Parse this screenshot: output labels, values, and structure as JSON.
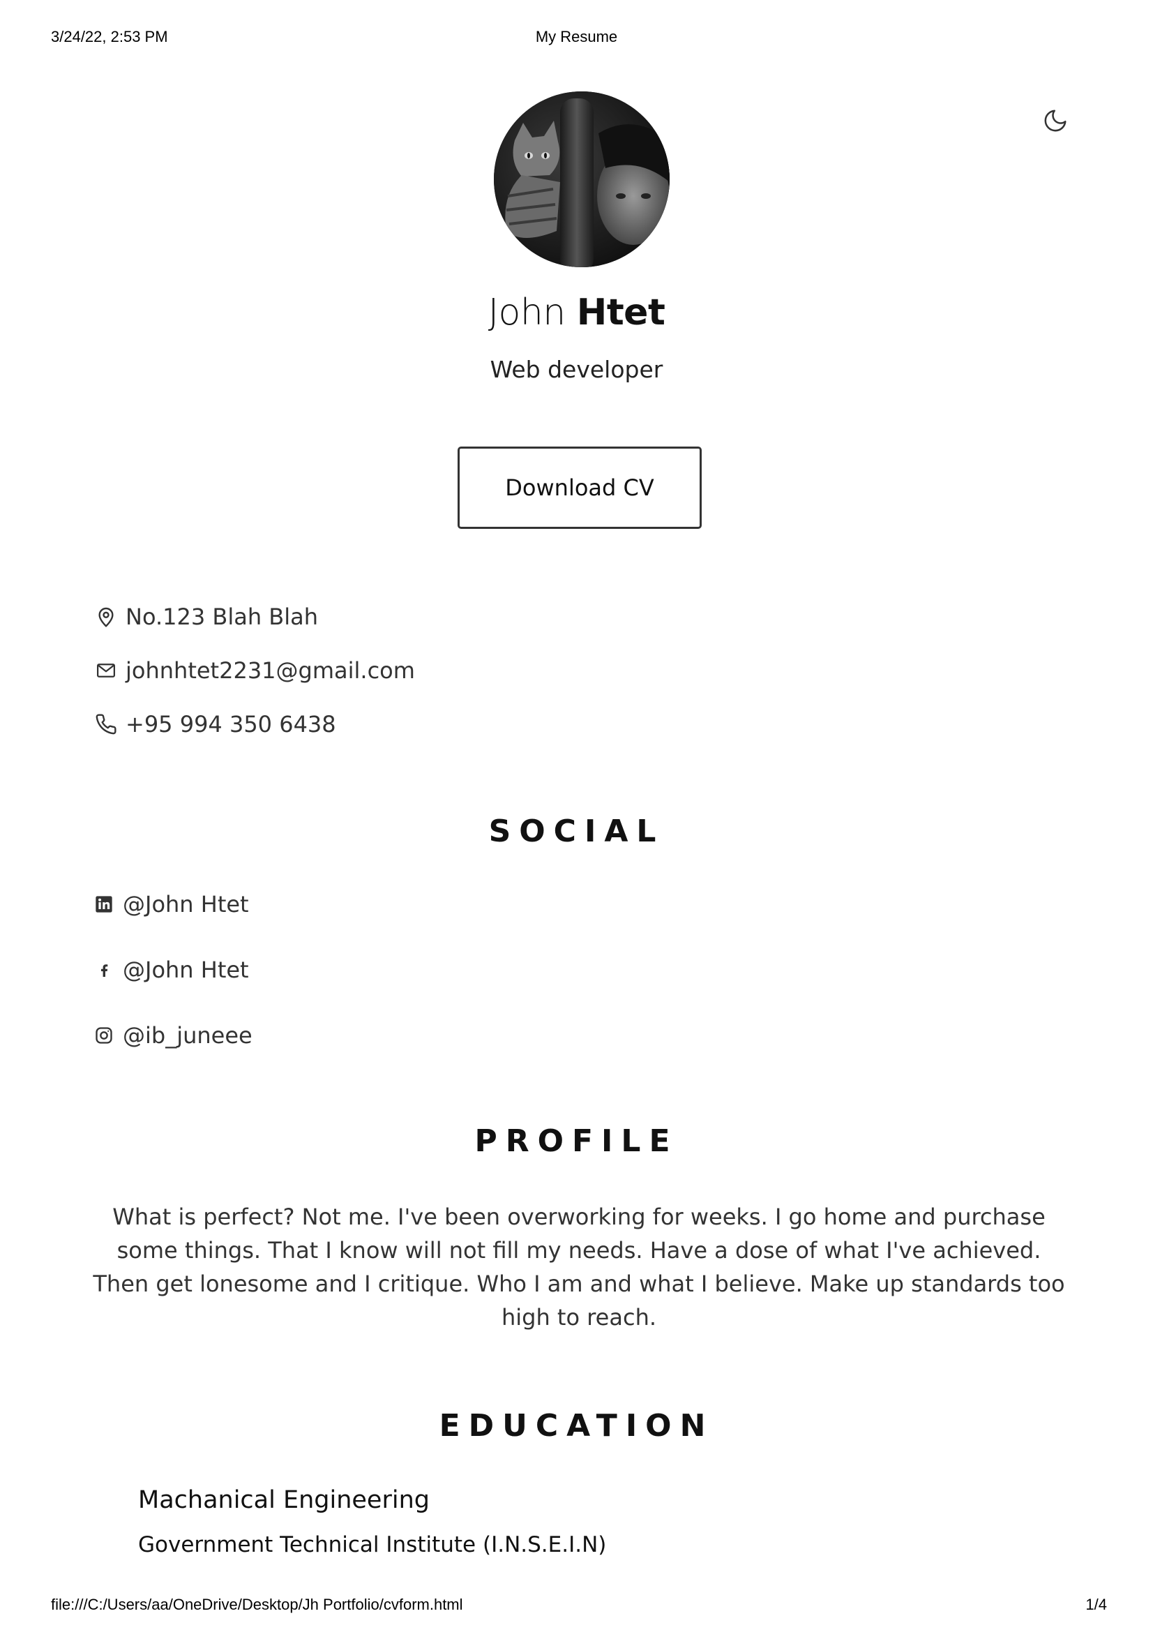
{
  "print": {
    "date": "3/24/22, 2:53 PM",
    "title": "My Resume",
    "url": "file:///C:/Users/aa/OneDrive/Desktop/Jh Portfolio/cvform.html",
    "page": "1/4"
  },
  "header": {
    "first_name": "John",
    "last_name": "Htet",
    "job": "Web developer",
    "download_label": "Download CV",
    "theme_icon": "moon-icon"
  },
  "contact": {
    "address": "No.123 Blah Blah",
    "email": "johnhtet2231@gmail.com",
    "phone": "+95 994 350 6438"
  },
  "social": {
    "title": "SOCIAL",
    "items": [
      {
        "icon": "linkedin-icon",
        "handle": "@John Htet"
      },
      {
        "icon": "facebook-icon",
        "handle": "@John Htet"
      },
      {
        "icon": "instagram-icon",
        "handle": "@ib_juneee"
      }
    ]
  },
  "profile": {
    "title": "PROFILE",
    "text": "What is perfect? Not me. I've been overworking for weeks. I go home and purchase some things. That I know will not fill my needs. Have a dose of what I've achieved. Then get lonesome and I critique. Who I am and what I believe. Make up standards too high to reach."
  },
  "education": {
    "title": "EDUCATION",
    "items": [
      {
        "degree": "Machanical Engineering",
        "school": "Government Technical Institute (I.N.S.E.I.N)"
      }
    ]
  }
}
